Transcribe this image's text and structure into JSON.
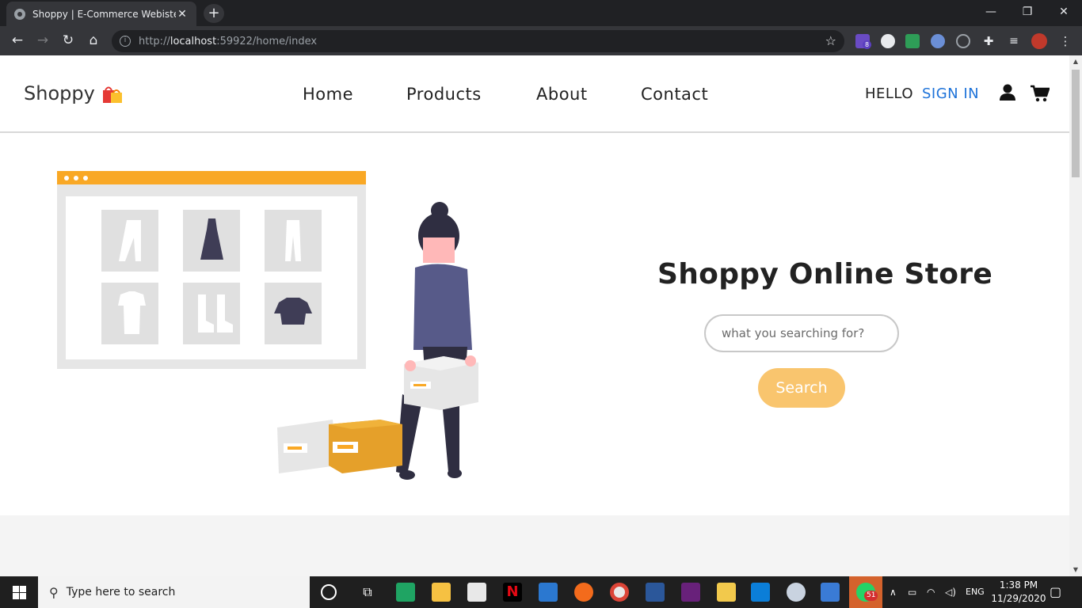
{
  "browser": {
    "tab_title": "Shoppy | E-Commerce Webiste",
    "tab_close": "✕",
    "new_tab": "+",
    "url_scheme": "http://",
    "url_host": "localhost",
    "url_rest": ":59922/home/index",
    "extension_badge": "8",
    "window_controls": {
      "minimize": "—",
      "restore": "❐",
      "close": "✕"
    }
  },
  "site": {
    "logo": "Shoppy",
    "nav": {
      "home": "Home",
      "products": "Products",
      "about": "About",
      "contact": "Contact"
    },
    "hello": "HELLO",
    "sign_in": "SIGN IN"
  },
  "hero": {
    "title": "Shoppy Online Store",
    "search_placeholder": "what you searching for?",
    "search_button": "Search"
  },
  "taskbar": {
    "search_placeholder": "Type here to search",
    "whatsapp_badge": "51",
    "language": "ENG",
    "time": "1:38 PM",
    "date": "11/29/2020"
  },
  "colors": {
    "accent_orange": "#f9a825",
    "signin_blue": "#1e73d9",
    "search_button": "#f9c56e"
  }
}
